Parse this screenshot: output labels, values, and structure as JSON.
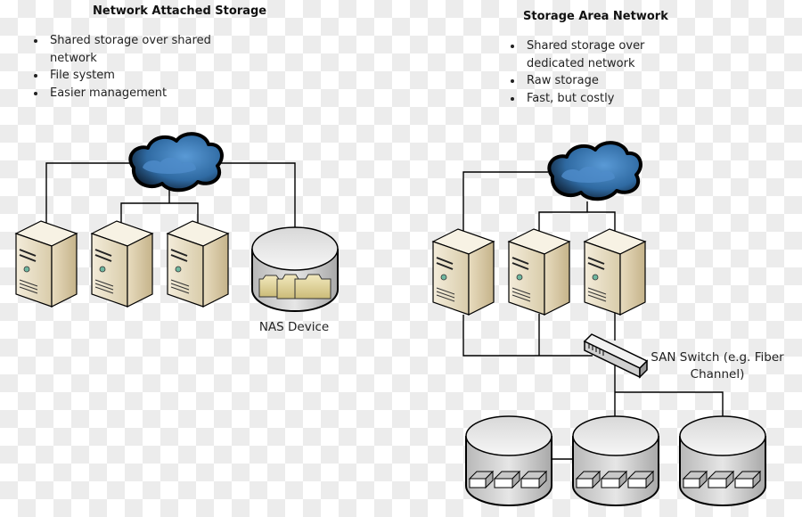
{
  "nas": {
    "title": "Network Attached Storage",
    "bullets": [
      "Shared storage over shared network",
      "File system",
      "Easier management"
    ],
    "device_label": "NAS Device",
    "servers": 3
  },
  "san": {
    "title": "Storage Area Network",
    "bullets": [
      "Shared storage over dedicated network",
      "Raw storage",
      "Fast, but costly"
    ],
    "switch_label_line1": "SAN Switch (e.g. Fiber",
    "switch_label_line2": "Channel)",
    "servers": 3,
    "disks": 3
  },
  "colors": {
    "cloud": "#3f7fbf",
    "cloud_dark": "#0d1a2a",
    "server": "#e8dcc0",
    "folder": "#e7dba0",
    "line": "#000000"
  }
}
